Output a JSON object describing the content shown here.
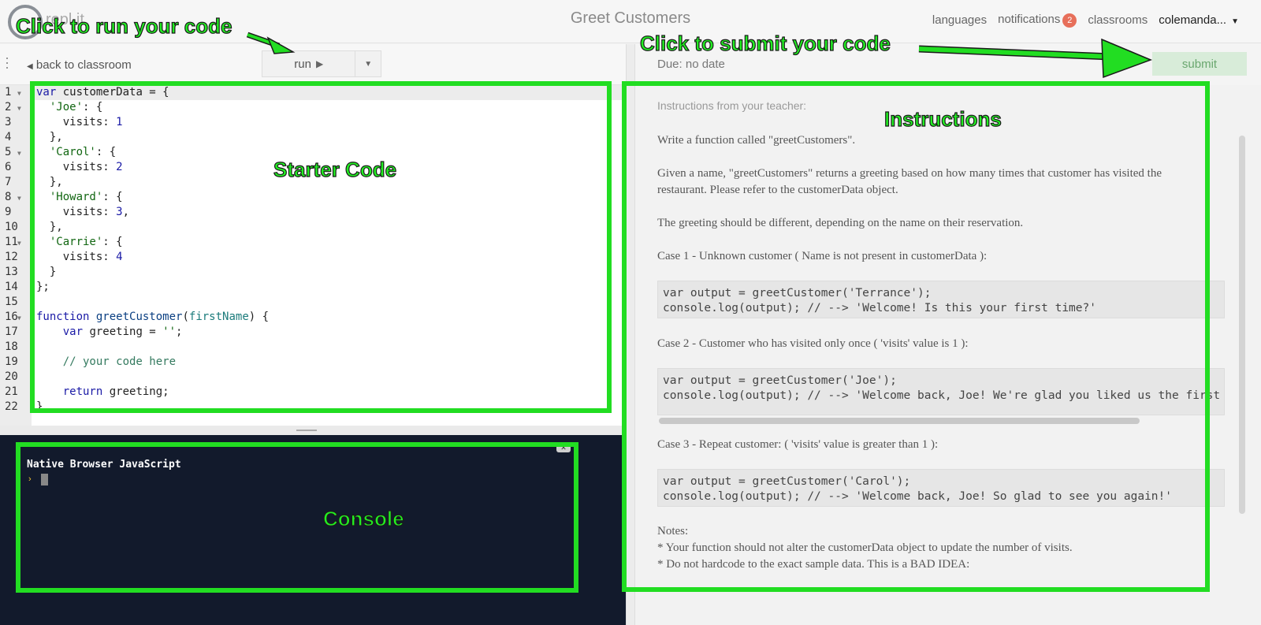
{
  "app": {
    "logo_text": "repl.it",
    "title": "Greet Customers"
  },
  "nav": {
    "languages": "languages",
    "notifications": "notifications",
    "notifications_count": "2",
    "classrooms": "classrooms",
    "user": "colemanda..."
  },
  "toolbar": {
    "back_label": "back to classroom",
    "run_label": "run"
  },
  "editor": {
    "lines": [
      {
        "n": "1",
        "fold": true,
        "text": "var customerData = {"
      },
      {
        "n": "2",
        "fold": true,
        "text": "  'Joe': {"
      },
      {
        "n": "3",
        "fold": false,
        "text": "    visits: 1"
      },
      {
        "n": "4",
        "fold": false,
        "text": "  },"
      },
      {
        "n": "5",
        "fold": true,
        "text": "  'Carol': {"
      },
      {
        "n": "6",
        "fold": false,
        "text": "    visits: 2"
      },
      {
        "n": "7",
        "fold": false,
        "text": "  },"
      },
      {
        "n": "8",
        "fold": true,
        "text": "  'Howard': {"
      },
      {
        "n": "9",
        "fold": false,
        "text": "    visits: 3,"
      },
      {
        "n": "10",
        "fold": false,
        "text": "  },"
      },
      {
        "n": "11",
        "fold": true,
        "text": "  'Carrie': {"
      },
      {
        "n": "12",
        "fold": false,
        "text": "    visits: 4"
      },
      {
        "n": "13",
        "fold": false,
        "text": "  }"
      },
      {
        "n": "14",
        "fold": false,
        "text": "};"
      },
      {
        "n": "15",
        "fold": false,
        "text": ""
      },
      {
        "n": "16",
        "fold": true,
        "text": "function greetCustomer(firstName) {"
      },
      {
        "n": "17",
        "fold": false,
        "text": "    var greeting = '';"
      },
      {
        "n": "18",
        "fold": false,
        "text": ""
      },
      {
        "n": "19",
        "fold": false,
        "text": "    // your code here"
      },
      {
        "n": "20",
        "fold": false,
        "text": ""
      },
      {
        "n": "21",
        "fold": false,
        "text": "    return greeting;"
      },
      {
        "n": "22",
        "fold": false,
        "text": "}"
      }
    ]
  },
  "console": {
    "label": "Native Browser JavaScript",
    "prompt": "›"
  },
  "assignment": {
    "due": "Due: no date",
    "submit_label": "submit"
  },
  "instructions": {
    "header": "Instructions from your teacher:",
    "p1": "Write a function called \"greetCustomers\".",
    "p2": "Given a name, \"greetCustomers\" returns a greeting based on how many times that customer has visited the restaurant.  Please refer to the customerData object.",
    "p3": "The greeting should be different, depending on the name on their reservation.",
    "case1_title": "Case 1 - Unknown customer ( Name is not present in customerData ):",
    "case1_code": "var output = greetCustomer('Terrance');\nconsole.log(output); // --> 'Welcome! Is this your first time?'",
    "case2_title": "Case 2 - Customer who has visited only once ( 'visits' value is 1 ):",
    "case2_code": "var output = greetCustomer('Joe');\nconsole.log(output); // --> 'Welcome back, Joe! We're glad you liked us the first time!'",
    "case3_title": "Case 3 - Repeat customer: ( 'visits' value is greater than 1 ):",
    "case3_code": "var output = greetCustomer('Carol');\nconsole.log(output); // --> 'Welcome back, Joe! So glad to see you again!'",
    "notes_title": "Notes:",
    "note1": "* Your function should not alter the customerData object to update the number of visits.",
    "note2": "* Do not hardcode to the exact sample data. This is a BAD IDEA:"
  },
  "annotations": {
    "run_callout": "Click to run your code",
    "submit_callout": "Click to submit your code",
    "starter_label": "Starter Code",
    "instructions_label": "Instructions",
    "console_label": "Console",
    "accent_color": "#22dd22"
  }
}
